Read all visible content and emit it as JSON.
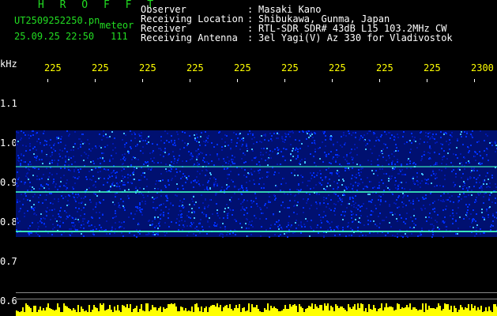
{
  "header": {
    "title": "H R O F F T",
    "file_name": "UT2509252250.pn",
    "meteor_label": "meteor",
    "datetime": "25.09.25 22:50",
    "count": "111",
    "fields": [
      {
        "label": "Observer",
        "colon": ":",
        "value": "Masaki Kano"
      },
      {
        "label": "Receiving Location",
        "colon": ":",
        "value": "Shibukawa, Gunma, Japan"
      },
      {
        "label": "Receiver",
        "colon": ":",
        "value": "RTL-SDR SDR# 43dB L15 103.2MHz CW"
      },
      {
        "label": "Receiving Antenna",
        "colon": ":",
        "value": "3el Yagi(V) Az 330 for Vladivostok"
      }
    ]
  },
  "axes": {
    "y_unit": "kHz",
    "x_ticks": [
      "225",
      "225",
      "225",
      "225",
      "225",
      "225",
      "225",
      "225",
      "225",
      "2300"
    ],
    "y_ticks": [
      "1.1",
      "1.0",
      "0.9",
      "0.8",
      "0.7",
      "0.6"
    ]
  },
  "colors": {
    "background": "#000000",
    "label_green": "#22dd22",
    "text_white": "#ffffff",
    "tick_yellow": "#ffff00",
    "noise_dark": "#001070",
    "noise_mid": "#0030ff",
    "noise_bright": "#40c0ff",
    "signal": "#40ffc0",
    "level_bar": "#ffff00"
  }
}
